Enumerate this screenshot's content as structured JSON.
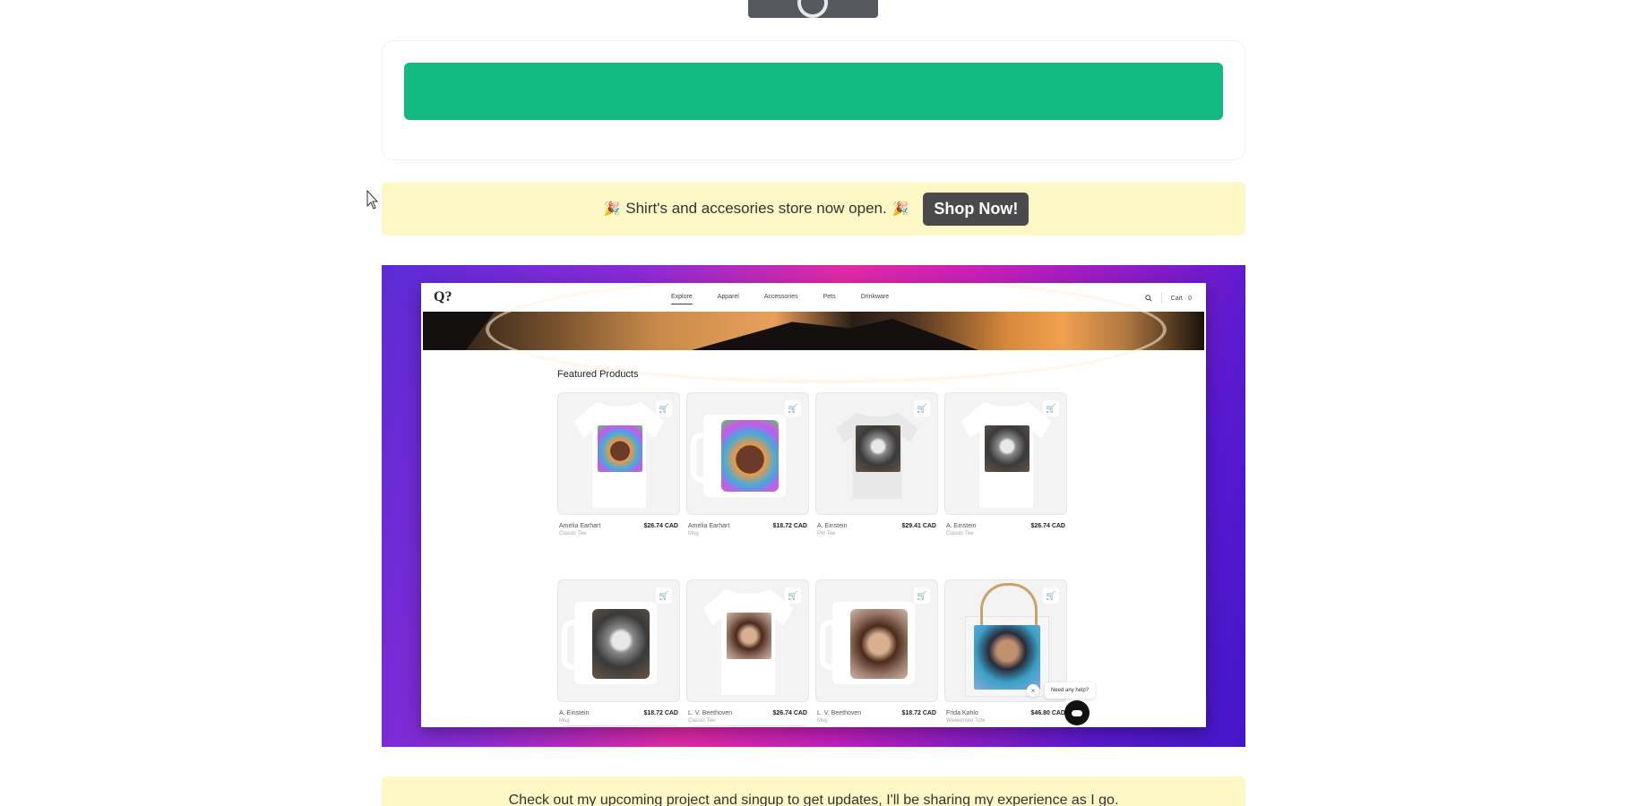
{
  "announcement": {
    "emoji": "🎉",
    "text": "Shirt's and accesories store now open.",
    "button_label": "Shop Now!"
  },
  "showcase": {
    "logo": "Q?",
    "nav": [
      "Explore",
      "Apparel",
      "Accessories",
      "Pets",
      "Drinkware"
    ],
    "active_nav": "Explore",
    "cart_label": "Cart · 0",
    "section_title": "Featured Products",
    "products": [
      {
        "name": "Amelia Earhart",
        "type": "Classic Tee",
        "price": "$26.74 CAD"
      },
      {
        "name": "Amelia Earhart",
        "type": "Mug",
        "price": "$18.72 CAD"
      },
      {
        "name": "A. Einstein",
        "type": "Pet Tee",
        "price": "$29.41 CAD"
      },
      {
        "name": "A. Einstein",
        "type": "Classic Tee",
        "price": "$26.74 CAD"
      },
      {
        "name": "A. Einstein",
        "type": "Mug",
        "price": "$18.72 CAD"
      },
      {
        "name": "L. V. Beethoven",
        "type": "Classic Tee",
        "price": "$26.74 CAD"
      },
      {
        "name": "L. V. Beethoven",
        "type": "Mug",
        "price": "$18.72 CAD"
      },
      {
        "name": "Frida Kahlo",
        "type": "Weekender Tote",
        "price": "$46.80 CAD"
      }
    ],
    "help_text": "Need any help?",
    "help_close": "×"
  },
  "bottom_banner": {
    "text": "Check out my upcoming project and singup to get updates, I'll be sharing my experience as I go."
  },
  "colors": {
    "primary_button": "#12b981",
    "banner_bg": "#fef8c6",
    "shop_button": "#4a4a4d"
  }
}
